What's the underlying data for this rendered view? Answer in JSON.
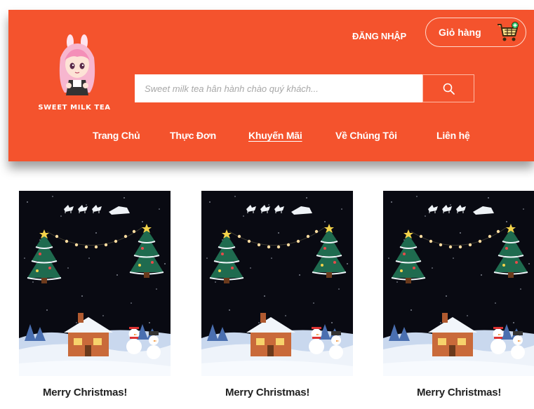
{
  "brand": {
    "logo_text": "SWEET MILK TEA"
  },
  "header": {
    "login_label": "ĐĂNG NHẬP",
    "cart_label": "Giỏ hàng",
    "search_placeholder": "Sweet milk tea hân hành chào quý khách..."
  },
  "nav": {
    "items": [
      {
        "label": "Trang Chủ",
        "active": false
      },
      {
        "label": "Thực Đơn",
        "active": false
      },
      {
        "label": "Khuyến Mãi",
        "active": true
      },
      {
        "label": "Về Chúng Tôi",
        "active": false
      },
      {
        "label": "Liên hệ",
        "active": false
      }
    ]
  },
  "promotions": [
    {
      "title": "Merry Christmas!",
      "image": "christmas-night-scene"
    },
    {
      "title": "Merry Christmas!",
      "image": "christmas-night-scene"
    },
    {
      "title": "Merry Christmas!",
      "image": "christmas-night-scene"
    }
  ],
  "colors": {
    "header_bg": "#f4532d",
    "text_dark": "#222222",
    "image_bg": "#090a12"
  }
}
